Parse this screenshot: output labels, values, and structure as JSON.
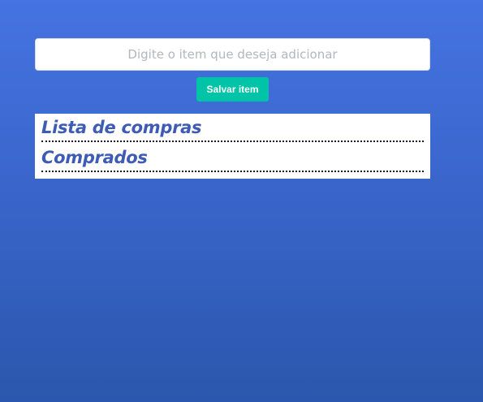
{
  "form": {
    "input_placeholder": "Digite o item que deseja adicionar",
    "input_value": "",
    "save_label": "Salvar item"
  },
  "lists": {
    "shopping_title": "Lista de compras",
    "shopping_items": [],
    "bought_title": "Comprados",
    "bought_items": []
  },
  "colors": {
    "background_top": "#4573e1",
    "background_bottom": "#2b57ad",
    "button": "#00c4a7",
    "heading": "#3e5bb5"
  }
}
